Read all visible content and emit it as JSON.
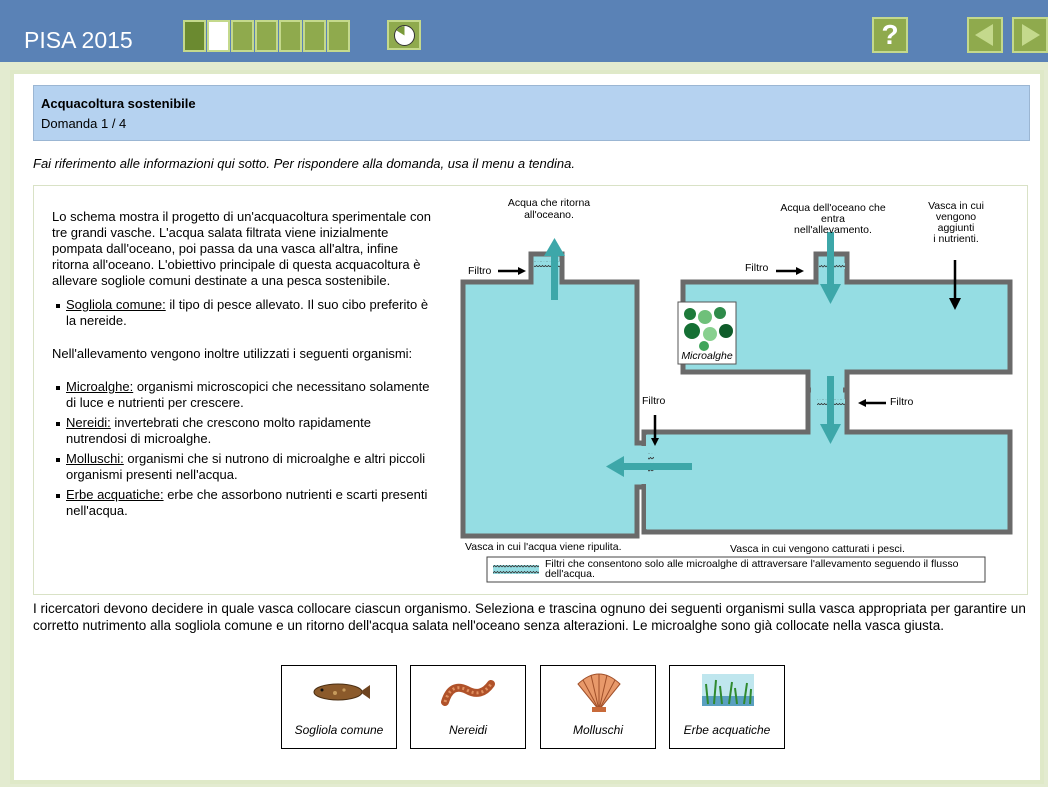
{
  "app": {
    "title": "PISA 2015"
  },
  "progress": {
    "total": 7,
    "completed": 1,
    "current": 2
  },
  "question": {
    "title": "Acquacoltura sostenibile",
    "number": "Domanda 1 / 4",
    "instruction": "Fai riferimento alle informazioni qui sotto. Per rispondere alla domanda, usa il menu a tendina.",
    "intro": "Lo schema mostra il progetto di un'acquacoltura sperimentale con tre grandi vasche. L'acqua salata filtrata viene inizialmente pompata dall'oceano, poi passa da una vasca all'altra, infine ritorna all'oceano. L'obiettivo principale di questa acquacoltura è allevare sogliole comuni destinate a una pesca sostenibile.",
    "species": [
      {
        "term": "Sogliola comune:",
        "desc": " il tipo di pesce allevato. Il suo cibo preferito è la nereide."
      }
    ],
    "organisms_intro": "Nell'allevamento vengono inoltre utilizzati i seguenti organismi:",
    "organisms": [
      {
        "term": "Microalghe:",
        "desc": " organismi microscopici che necessitano solamente di luce e nutrienti per crescere."
      },
      {
        "term": "Nereidi:",
        "desc": " invertebrati che crescono molto rapidamente nutrendosi di microalghe."
      },
      {
        "term": "Molluschi:",
        "desc": " organismi che si nutrono di microalghe e altri piccoli organismi presenti nell'acqua."
      },
      {
        "term": "Erbe acquatiche:",
        "desc": " erbe che assorbono nutrienti e scarti presenti nell'acqua."
      }
    ],
    "prompt": "I ricercatori devono decidere in quale vasca collocare ciascun organismo. Seleziona e trascina ognuno dei seguenti organismi sulla vasca appropriata per garantire un corretto nutrimento alla sogliola comune e un ritorno dell'acqua salata nell'oceano senza alterazioni. Le microalghe sono già collocate nella vasca giusta."
  },
  "diagram": {
    "return_label": [
      "Acqua che ritorna",
      "all'oceano."
    ],
    "intake_label": [
      "Acqua dell'oceano che",
      "entra",
      "nell'allevamento."
    ],
    "nutrient_label": [
      "Vasca in cui",
      "vengono",
      "aggiunti",
      "i nutrienti."
    ],
    "filter": "Filtro",
    "microalgae": "Microalghe",
    "clean_tank": "Vasca in cui l'acqua viene ripulita.",
    "fish_tank": "Vasca in cui vengono catturati i pesci.",
    "legend": [
      "Filtri che consentono solo alle microalghe di attraversare l'allevamento seguendo il flusso",
      "dell'acqua."
    ]
  },
  "cards": [
    {
      "label": "Sogliola comune",
      "icon": "sole-fish-icon"
    },
    {
      "label": "Nereidi",
      "icon": "nereid-worm-icon"
    },
    {
      "label": "Molluschi",
      "icon": "scallop-shell-icon"
    },
    {
      "label": "Erbe acquatiche",
      "icon": "seagrass-icon"
    }
  ],
  "colors": {
    "header": "#5a82b6",
    "water": "#95dde3",
    "arrow": "#3da7a9",
    "nav_green": "#8faa4d"
  }
}
